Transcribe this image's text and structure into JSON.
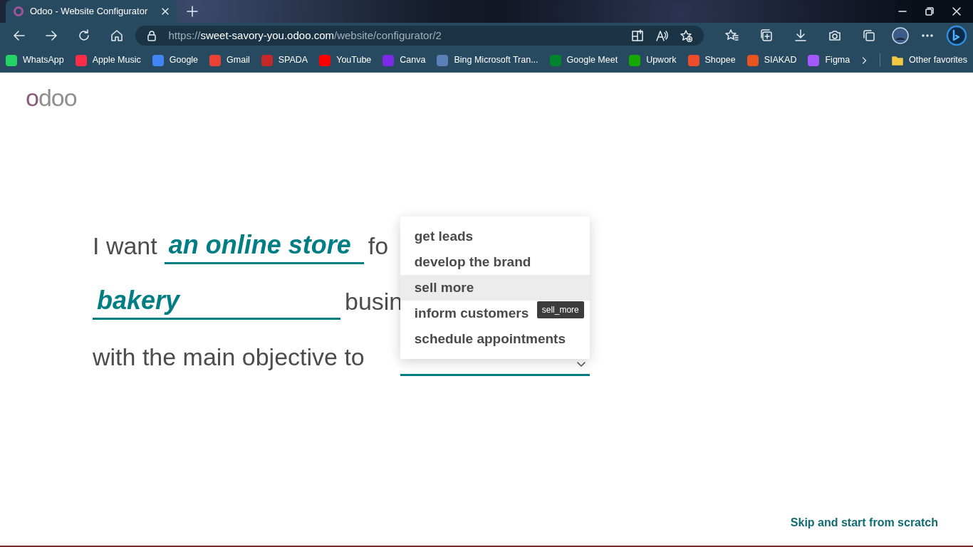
{
  "browser": {
    "tab": {
      "title": "Odoo - Website Configurator",
      "selected": true
    },
    "address": {
      "scheme": "https://",
      "host": "sweet-savory-you.odoo.com",
      "path": "/website/configurator/2"
    },
    "bookmarks": [
      {
        "label": "WhatsApp",
        "color": "#25d366"
      },
      {
        "label": "Apple Music",
        "color": "#fa2d48"
      },
      {
        "label": "Google",
        "color": "#4285f4"
      },
      {
        "label": "Gmail",
        "color": "#ea4335"
      },
      {
        "label": "SPADA",
        "color": "#c62828"
      },
      {
        "label": "YouTube",
        "color": "#ff0000"
      },
      {
        "label": "Canva",
        "color": "#7d2ae8"
      },
      {
        "label": "Bing Microsoft Tran...",
        "color": "#5b7fb9"
      },
      {
        "label": "Google Meet",
        "color": "#00832d"
      },
      {
        "label": "Upwork",
        "color": "#14a800"
      },
      {
        "label": "Shopee",
        "color": "#ee4d2d"
      },
      {
        "label": "SIAKAD",
        "color": "#e8541e"
      },
      {
        "label": "Figma",
        "color": "#a259ff"
      }
    ],
    "other_favorites": "Other favorites"
  },
  "logo": "odoo",
  "lines": [
    [
      {
        "kind": "text",
        "text": "I want"
      },
      {
        "kind": "field",
        "value": "an online store"
      },
      {
        "kind": "text",
        "text": "fo"
      }
    ],
    [
      {
        "kind": "field",
        "value": "bakery"
      },
      {
        "kind": "text",
        "text": "busin"
      }
    ],
    [
      {
        "kind": "text",
        "text": "with the main objective to"
      },
      {
        "kind": "select",
        "expanded": true
      }
    ]
  ],
  "dropdown": {
    "options": [
      {
        "label": "get leads",
        "selected": false
      },
      {
        "label": "develop the brand",
        "selected": false
      },
      {
        "label": "sell more",
        "selected": true
      },
      {
        "label": "inform customers",
        "selected": false
      },
      {
        "label": "schedule appointments",
        "selected": false
      }
    ],
    "tooltip": "sell_more"
  },
  "skip_link": "Skip and start from scratch"
}
